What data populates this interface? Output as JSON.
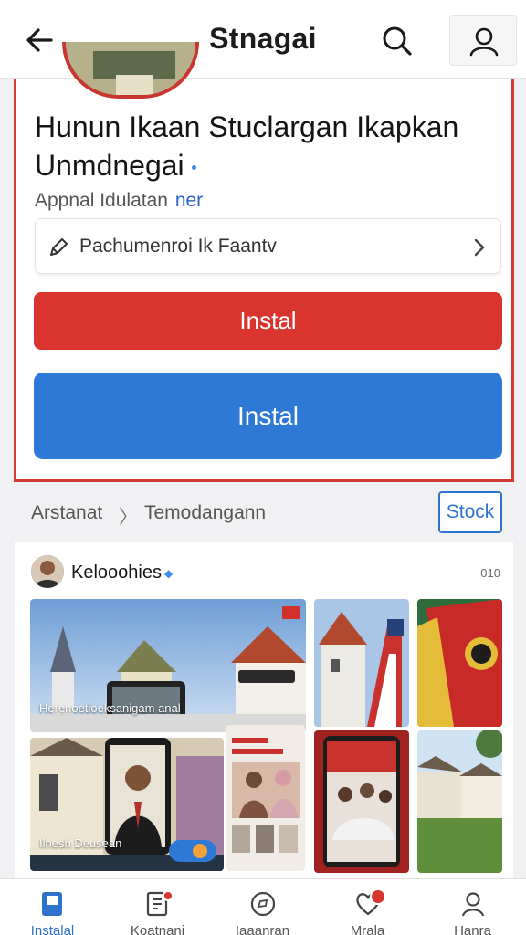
{
  "header": {
    "title": "Stnagai",
    "back_icon": "arrow-left-icon",
    "search_icon": "search-icon",
    "profile_icon": "user-icon"
  },
  "app": {
    "title_line1": "Hunun Ikaan Stuclargan Ikapkan",
    "title_line2": "Unmdnegai",
    "developer": "Appnal Idulatan",
    "developer_tag": "ner",
    "info_text": "Pachumenroi Ik Faantv",
    "install_label_primary": "Instal",
    "install_label_secondary": "Instal"
  },
  "breadcrumb": {
    "item1": "Arstanat",
    "separator": "〉",
    "item2": "Temodangann",
    "action_button": "Stock"
  },
  "feed": {
    "author": "Kelooohies",
    "verified_mark": "◆",
    "count": "010",
    "photo1_caption": "Herenoetioeksanigam anal",
    "photo5_caption": "Ilnesh Deusean"
  },
  "bottom_nav": {
    "items": [
      {
        "label": "Instalal",
        "icon": "bookmark-icon",
        "active": true
      },
      {
        "label": "Koatnani",
        "icon": "document-icon",
        "badge": true
      },
      {
        "label": "Iaaanran",
        "icon": "message-icon"
      },
      {
        "label": "Mrala",
        "icon": "heart-icon",
        "badge": true
      },
      {
        "label": "Hanra",
        "icon": "user-icon"
      }
    ]
  },
  "colors": {
    "accent_blue": "#2f79d6",
    "accent_red": "#d9342d",
    "background": "#f1f1f3"
  }
}
